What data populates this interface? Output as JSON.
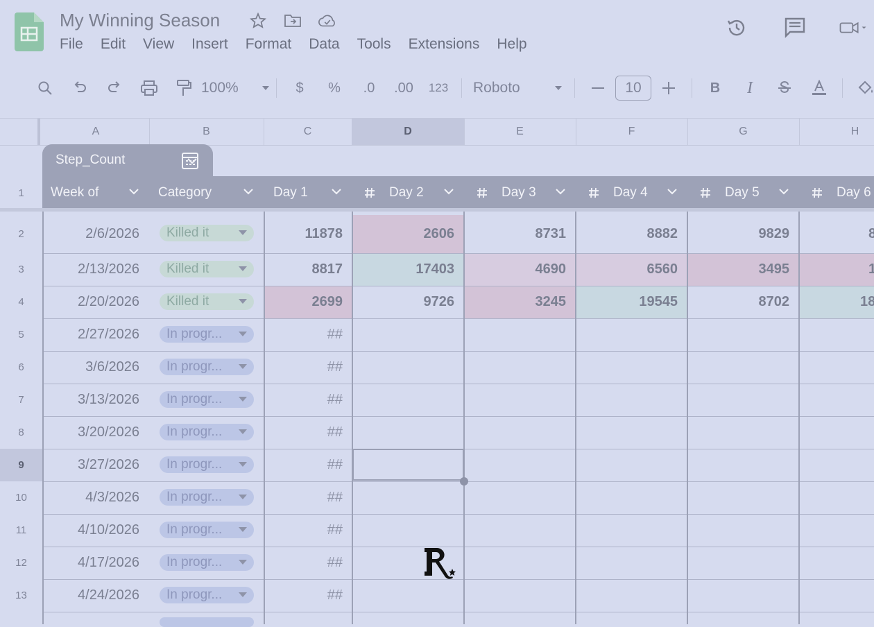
{
  "app": {
    "doc_title": "My Winning Season"
  },
  "menu": [
    "File",
    "Edit",
    "View",
    "Insert",
    "Format",
    "Data",
    "Tools",
    "Extensions",
    "Help"
  ],
  "toolbar": {
    "zoom": "100%",
    "currency": "$",
    "percent": "%",
    "dec_decrease": ".0",
    "dec_increase": ".00",
    "format_123": "123",
    "font": "Roboto",
    "font_size": "10",
    "bold": "B",
    "italic": "I"
  },
  "columns": [
    "A",
    "B",
    "C",
    "D",
    "E",
    "F",
    "G",
    "H"
  ],
  "selected_column": "D",
  "table": {
    "name": "Step_Count",
    "headers": [
      "Week of",
      "Category",
      "Day 1",
      "Day 2",
      "Day 3",
      "Day 4",
      "Day 5",
      "Day 6"
    ]
  },
  "rows": [
    {
      "num": "2",
      "date": "2/6/2026",
      "category": "Killed it",
      "days": [
        "11878",
        "2606",
        "8731",
        "8882",
        "9829",
        "8"
      ]
    },
    {
      "num": "3",
      "date": "2/13/2026",
      "category": "Killed it",
      "days": [
        "8817",
        "17403",
        "4690",
        "6560",
        "3495",
        "1"
      ]
    },
    {
      "num": "4",
      "date": "2/20/2026",
      "category": "Killed it",
      "days": [
        "2699",
        "9726",
        "3245",
        "19545",
        "8702",
        "18"
      ]
    },
    {
      "num": "5",
      "date": "2/27/2026",
      "category": "In progr...",
      "days": [
        "##"
      ]
    },
    {
      "num": "6",
      "date": "3/6/2026",
      "category": "In progr...",
      "days": [
        "##"
      ]
    },
    {
      "num": "7",
      "date": "3/13/2026",
      "category": "In progr...",
      "days": [
        "##"
      ]
    },
    {
      "num": "8",
      "date": "3/20/2026",
      "category": "In progr...",
      "days": [
        "##"
      ]
    },
    {
      "num": "9",
      "date": "3/27/2026",
      "category": "In progr...",
      "days": [
        "##"
      ]
    },
    {
      "num": "10",
      "date": "4/3/2026",
      "category": "In progr...",
      "days": [
        "##"
      ]
    },
    {
      "num": "11",
      "date": "4/10/2026",
      "category": "In progr...",
      "days": [
        "##"
      ]
    },
    {
      "num": "12",
      "date": "4/17/2026",
      "category": "In progr...",
      "days": [
        "##"
      ]
    },
    {
      "num": "13",
      "date": "4/24/2026",
      "category": "In progr...",
      "days": [
        "##"
      ]
    }
  ],
  "header_row_num": "1",
  "selected_row": "9",
  "watermark": "R",
  "colors": {
    "pink": "#d3c3d7",
    "light_pink": "#d7cce0",
    "teal": "#c8d8e1",
    "header": "#9da2b7",
    "background": "#d6dbef"
  }
}
